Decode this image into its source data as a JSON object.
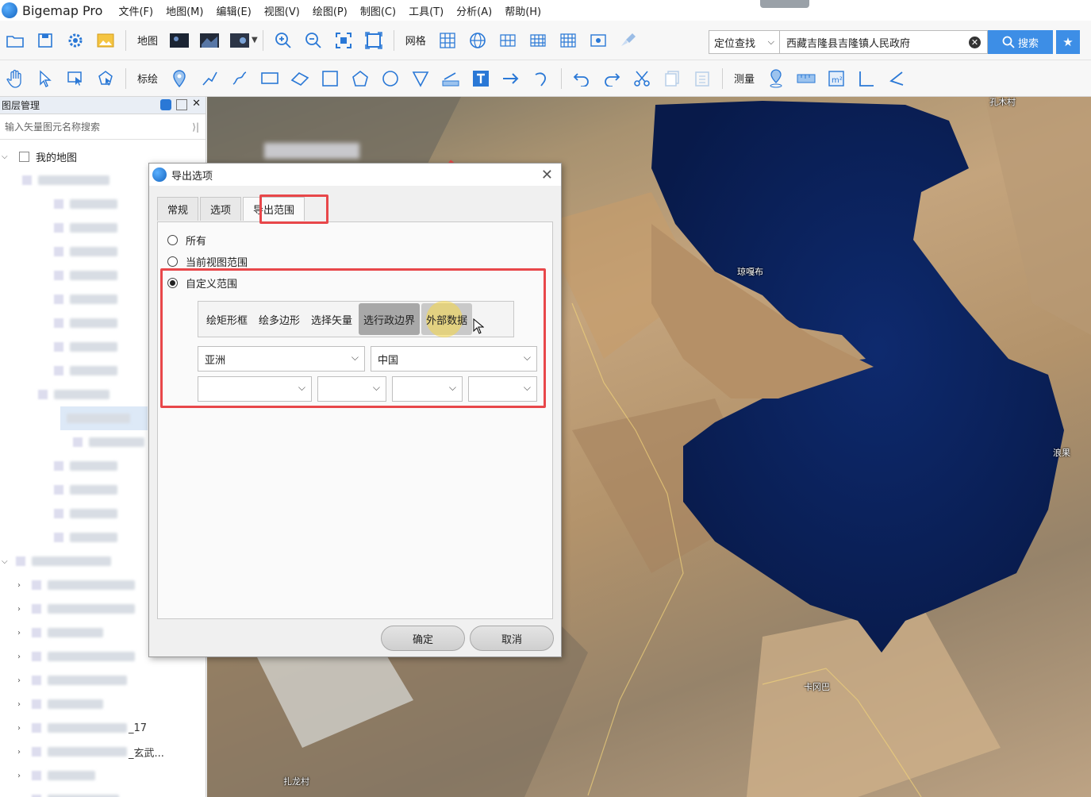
{
  "app": {
    "title": "Bigemap Pro"
  },
  "menu": [
    "文件(F)",
    "地图(M)",
    "编辑(E)",
    "视图(V)",
    "绘图(P)",
    "制图(C)",
    "工具(T)",
    "分析(A)",
    "帮助(H)"
  ],
  "toolbar1": {
    "map_label": "地图",
    "grid_label": "网格",
    "location_select": "定位查找",
    "location_value": "西藏吉隆县吉隆镇人民政府",
    "search_label": "搜索"
  },
  "toolbar2": {
    "mark_label": "标绘",
    "measure_label": "测量"
  },
  "layer_panel": {
    "title": "图层管理",
    "search_placeholder": "输入矢量图元名称搜索",
    "root": "我的地图",
    "suffix_17": "_17",
    "suffix_xuanwu": "_玄武..."
  },
  "map_labels": {
    "north": "孔木村",
    "west": "琼嘎布",
    "east": "浪果",
    "south": "卡冈巴",
    "southwest": "扎龙村"
  },
  "dialog": {
    "title": "导出选项",
    "tabs": [
      "常规",
      "选项",
      "导出范围"
    ],
    "active_tab": "导出范围",
    "radios": [
      "所有",
      "当前视图范围",
      "自定义范围"
    ],
    "selected_radio": "自定义范围",
    "range_buttons": [
      "绘矩形框",
      "绘多边形",
      "选择矢量",
      "选行政边界",
      "外部数据"
    ],
    "selected_range_button": "选行政边界",
    "continent": "亚洲",
    "country": "中国",
    "ok": "确定",
    "cancel": "取消"
  },
  "colors": {
    "accent": "#3d8ee6",
    "annotation": "#e8474a",
    "lake": "#0c2463"
  }
}
